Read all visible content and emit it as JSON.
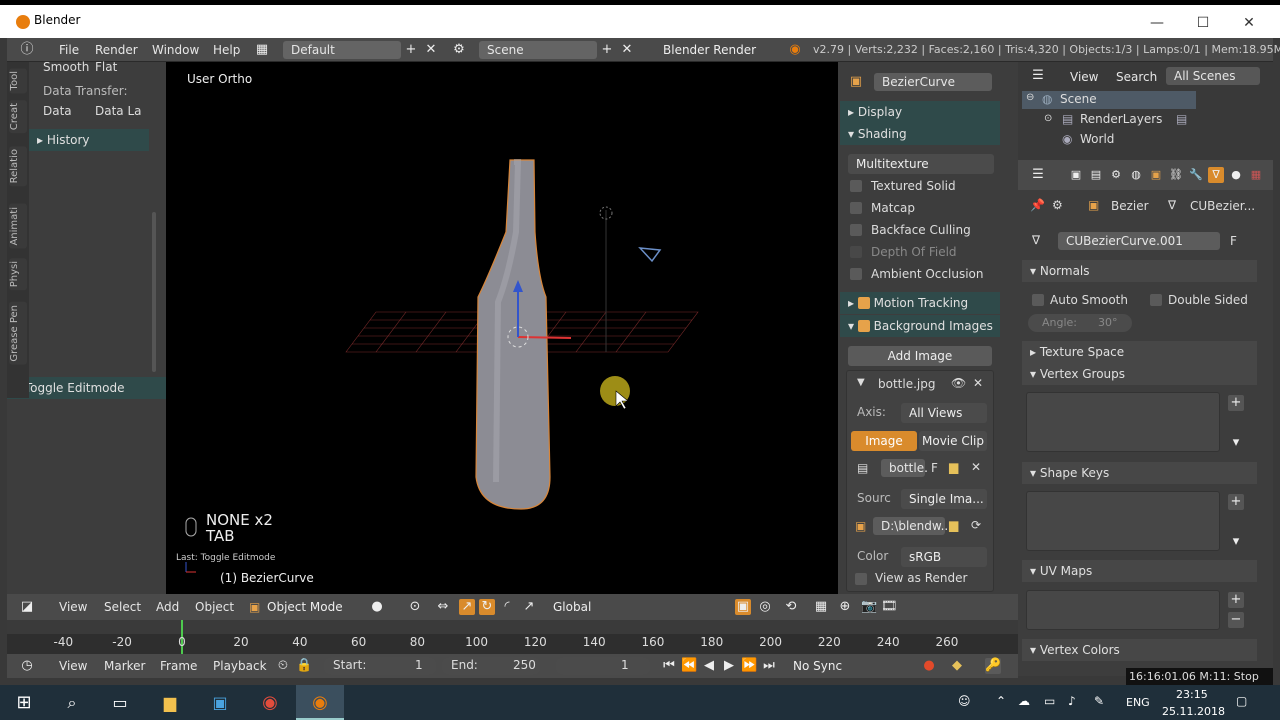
{
  "window": {
    "title": "Blender",
    "minimize": "—",
    "maximize": "☐",
    "close": "✕"
  },
  "topbar": {
    "menus": [
      "File",
      "Render",
      "Window",
      "Help"
    ],
    "layout": "Default",
    "scene": "Scene",
    "engine": "Blender Render",
    "stats": "v2.79 | Verts:2,232 | Faces:2,160 | Tris:4,320 | Objects:1/3 | Lamps:0/1 | Mem:18.95M"
  },
  "left": {
    "tabs": [
      "Tool",
      "Creat",
      "Relatio",
      "Animati",
      "Physi",
      "Grease Pen"
    ],
    "shading": {
      "smooth": "Smooth",
      "flat": "Flat"
    },
    "data_transfer": {
      "label": "Data Transfer:",
      "data": "Data",
      "data_layers": "Data La"
    },
    "history": "History",
    "toggle_editmode": "Toggle Editmode"
  },
  "viewport": {
    "view_name": "User Ortho",
    "key_line1": "NONE x2",
    "key_line2": "TAB",
    "last_op": "Last: Toggle Editmode",
    "object": "(1) BezierCurve"
  },
  "props_n": {
    "object_name": "BezierCurve",
    "display": "Display",
    "shading": "Shading",
    "shading_mode": "Multitexture",
    "options": [
      {
        "label": "Textured Solid",
        "enabled": true
      },
      {
        "label": "Matcap",
        "enabled": true
      },
      {
        "label": "Backface Culling",
        "enabled": true
      },
      {
        "label": "Depth Of Field",
        "enabled": false
      },
      {
        "label": "Ambient Occlusion",
        "enabled": true
      }
    ],
    "motion_tracking": "Motion Tracking",
    "background_images": "Background Images",
    "add_image": "Add Image",
    "image_name": "bottle.jpg",
    "axis_label": "Axis:",
    "axis_value": "All Views",
    "tab_image": "Image",
    "tab_movie": "Movie Clip",
    "img_field": "bottle.",
    "img_f": "F",
    "source_label": "Sourc",
    "source_value": "Single Ima...",
    "path": "D:\\blendw...",
    "color_label": "Color",
    "color_value": "sRGB",
    "view_as_render": "View as Render"
  },
  "outliner": {
    "view": "View",
    "search": "Search",
    "filter": "All Scenes",
    "items": [
      "Scene",
      "RenderLayers",
      "World"
    ]
  },
  "props_r": {
    "breadcrumb_obj": "Bezier",
    "breadcrumb_data": "CUBezier...",
    "datablock": "CUBezierCurve.001",
    "fake": "F",
    "normals": "Normals",
    "auto_smooth": "Auto Smooth",
    "double_sided": "Double Sided",
    "angle_label": "Angle:",
    "angle_value": "30°",
    "texture_space": "Texture Space",
    "vertex_groups": "Vertex Groups",
    "shape_keys": "Shape Keys",
    "uv_maps": "UV Maps",
    "vertex_colors": "Vertex Colors"
  },
  "vpheader": {
    "view": "View",
    "select": "Select",
    "add": "Add",
    "object": "Object",
    "mode": "Object Mode",
    "orientation": "Global"
  },
  "timeline": {
    "ticks": [
      "-40",
      "-20",
      "0",
      "20",
      "40",
      "60",
      "80",
      "100",
      "120",
      "140",
      "160",
      "180",
      "200",
      "220",
      "240",
      "260"
    ]
  },
  "tlfooter": {
    "view": "View",
    "marker": "Marker",
    "frame": "Frame",
    "playback": "Playback",
    "start_label": "Start:",
    "start": "1",
    "end_label": "End:",
    "end": "250",
    "current": "1",
    "sync": "No Sync"
  },
  "overlay": "16:16:01.06 M:11: Stop",
  "taskbar": {
    "lang": "ENG",
    "time": "23:15",
    "date": "25.11.2018"
  },
  "colors": {
    "accent": "#d98b2c",
    "header_teal": "#2f4a4a",
    "blender_orange": "#e87d0d"
  }
}
